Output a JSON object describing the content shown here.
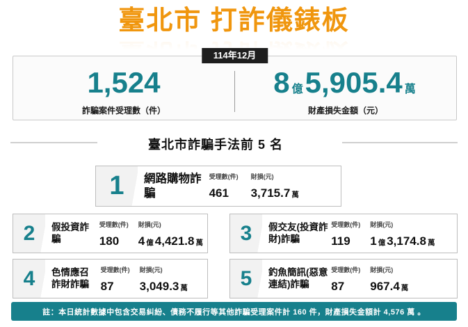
{
  "title": "臺北市 打詐儀錶板",
  "period_badge": "114年12月",
  "summary": {
    "cases": {
      "value": "1,524",
      "label": "詐騙案件受理數（件）"
    },
    "loss": {
      "big1": "8",
      "unit1": "億",
      "big2": "5,905.4",
      "unit2": "萬",
      "label": "財產損失金額（元）"
    }
  },
  "section_title": "臺北市詐騙手法前 5 名",
  "labels": {
    "count_header": "受理數(件)",
    "loss_header": "財損(元)"
  },
  "cards": [
    {
      "rank": "1",
      "name": "網路購物詐騙",
      "count": "461",
      "loss_big1": "",
      "loss_unit1": "",
      "loss_big2": "3,715.7",
      "loss_unit2": "萬"
    },
    {
      "rank": "2",
      "name": "假投資詐騙",
      "count": "180",
      "loss_big1": "4",
      "loss_unit1": "億",
      "loss_big2": "4,421.8",
      "loss_unit2": "萬"
    },
    {
      "rank": "3",
      "name": "假交友(投資詐財)詐騙",
      "count": "119",
      "loss_big1": "1",
      "loss_unit1": "億",
      "loss_big2": "3,174.8",
      "loss_unit2": "萬"
    },
    {
      "rank": "4",
      "name": "色情應召詐財詐騙",
      "count": "87",
      "loss_big1": "",
      "loss_unit1": "",
      "loss_big2": "3,049.3",
      "loss_unit2": "萬"
    },
    {
      "rank": "5",
      "name": "釣魚簡訊(惡意連結)詐騙",
      "count": "87",
      "loss_big1": "",
      "loss_unit1": "",
      "loss_big2": "967.4",
      "loss_unit2": "萬"
    }
  ],
  "footnote": "註：本日統計數據中包含交易糾紛、債務不履行等其他詐騙受理案件計 160 件，財產損失金額計 4,576 萬 。",
  "colors": {
    "title_orange": "#F0960E",
    "accent_teal": "#17808C",
    "badge_black": "#1E1E1E",
    "footer_teal": "#17808C"
  },
  "chart_data": {
    "type": "table",
    "title": "臺北市 打詐儀錶板",
    "period": "114年12月",
    "kpis": [
      {
        "label": "詐騙案件受理數（件）",
        "value": 1524
      },
      {
        "label": "財產損失金額（元）",
        "value": "8億5,905.4萬"
      }
    ],
    "table_title": "臺北市詐騙手法前 5 名",
    "columns": [
      "受理數(件)",
      "財損(元)"
    ],
    "rows": [
      {
        "rank": 1,
        "name": "網路購物詐騙",
        "count": 461,
        "loss": "3,715.7萬"
      },
      {
        "rank": 2,
        "name": "假投資詐騙",
        "count": 180,
        "loss": "4億4,421.8萬"
      },
      {
        "rank": 3,
        "name": "假交友(投資詐財)詐騙",
        "count": 119,
        "loss": "1億3,174.8萬"
      },
      {
        "rank": 4,
        "name": "色情應召詐財詐騙",
        "count": 87,
        "loss": "3,049.3萬"
      },
      {
        "rank": 5,
        "name": "釣魚簡訊(惡意連結)詐騙",
        "count": 87,
        "loss": "967.4萬"
      }
    ],
    "note": "註：本日統計數據中包含交易糾紛、債務不履行等其他詐騙受理案件計 160 件，財產損失金額計 4,576 萬 。"
  }
}
